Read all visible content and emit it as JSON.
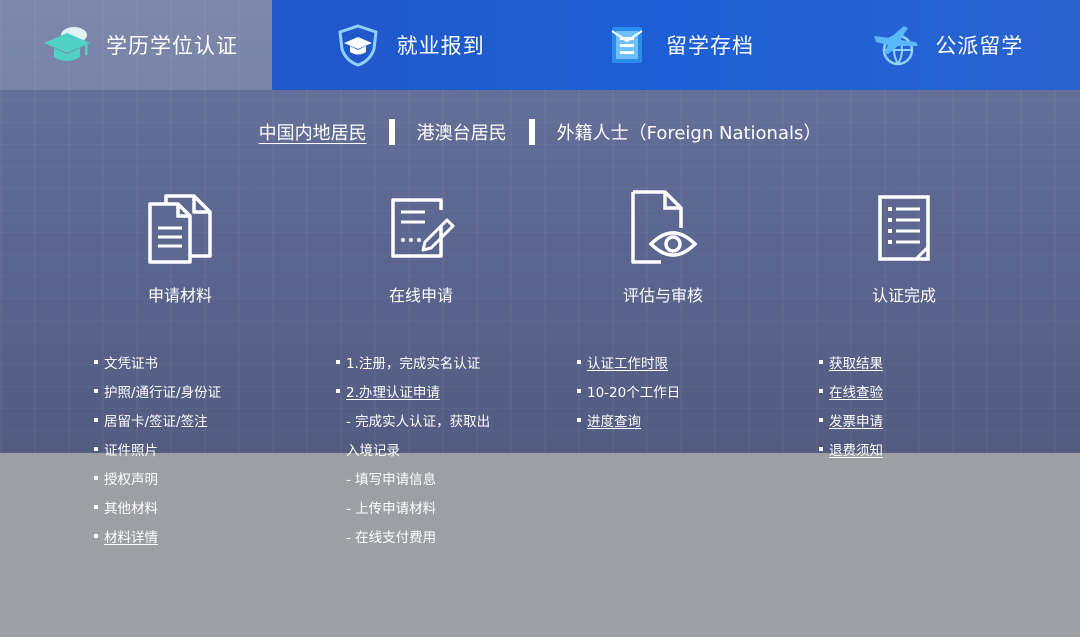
{
  "tabs": [
    {
      "label": "学历学位认证",
      "icon": "graduation-cap-icon",
      "active": true
    },
    {
      "label": "就业报到",
      "icon": "shield-cap-icon",
      "active": false
    },
    {
      "label": "留学存档",
      "icon": "archive-folder-icon",
      "active": false
    },
    {
      "label": "公派留学",
      "icon": "plane-globe-icon",
      "active": false
    }
  ],
  "region": {
    "options": [
      "中国内地居民",
      "港澳台居民",
      "外籍人士（Foreign Nationals）"
    ],
    "selected": 0
  },
  "steps": [
    {
      "title": "申请材料",
      "icon": "documents-icon"
    },
    {
      "title": "在线申请",
      "icon": "edit-form-icon"
    },
    {
      "title": "评估与审核",
      "icon": "review-eye-icon"
    },
    {
      "title": "认证完成",
      "icon": "checklist-icon"
    }
  ],
  "columns": [
    {
      "items": [
        {
          "text": "文凭证书"
        },
        {
          "text": "护照/通行证/身份证"
        },
        {
          "text": "居留卡/签证/签注"
        },
        {
          "text": "证件照片"
        },
        {
          "text": "授权声明"
        },
        {
          "text": "其他材料"
        },
        {
          "text": "材料详情",
          "link": true
        }
      ]
    },
    {
      "items": [
        {
          "text": "1.注册，完成实名认证"
        },
        {
          "text": "2.办理认证申请",
          "link": true
        },
        {
          "text": "- 完成实人认证，获取出",
          "sub": true
        },
        {
          "text": "入境记录",
          "sub": true
        },
        {
          "text": "- 填写申请信息",
          "sub": true
        },
        {
          "text": "- 上传申请材料",
          "sub": true
        },
        {
          "text": "- 在线支付费用",
          "sub": true
        }
      ]
    },
    {
      "items": [
        {
          "text": "认证工作时限",
          "link": true
        },
        {
          "text": "10-20个工作日"
        },
        {
          "text": "进度查询",
          "link": true
        }
      ]
    },
    {
      "items": [
        {
          "text": "获取结果",
          "link": true
        },
        {
          "text": "在线查验",
          "link": true
        },
        {
          "text": "发票申请",
          "link": true
        },
        {
          "text": "退费须知",
          "link": true
        }
      ]
    }
  ],
  "colors": {
    "tab_blue": "#1d5fd6",
    "accent_teal": "#4fd1c5",
    "icon_blue": "#2b8cf0"
  }
}
